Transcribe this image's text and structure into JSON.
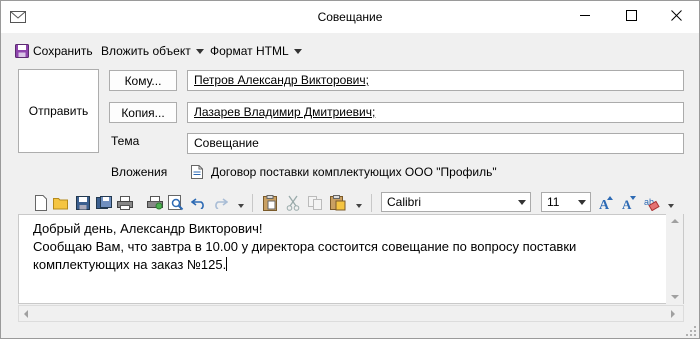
{
  "window": {
    "title": "Совещание",
    "controls": [
      "minimize-icon",
      "maximize-icon",
      "close-icon"
    ]
  },
  "menu": {
    "save": "Сохранить",
    "attach": "Вложить объект",
    "format": "Формат HTML"
  },
  "compose": {
    "send": "Отправить",
    "to_button": "Кому...",
    "to_value": "Петров Александр Викторович;",
    "cc_button": "Копия...",
    "cc_value": "Лазарев Владимир Дмитриевич;",
    "subject_label": "Тема",
    "subject_value": "Совещание",
    "attachments_label": "Вложения",
    "attachment_name": "Договор поставки комплектующих ООО \"Профиль\""
  },
  "toolbar": {
    "icons": [
      "new-document-icon",
      "open-folder-icon",
      "save-icon",
      "save-as-icon",
      "print-icon",
      "print-setup-icon",
      "print-preview-icon",
      "undo-icon",
      "redo-icon",
      "paste-icon",
      "cut-icon",
      "copy-icon",
      "paste-special-icon",
      "grow-font-icon",
      "shrink-font-icon",
      "clear-format-icon"
    ],
    "font_name": "Calibri",
    "font_size": "11"
  },
  "body": {
    "line1": "Добрый день, Александр Викторович!",
    "line2": "Сообщаю Вам, что завтра в 10.00 у директора состоится совещание по вопросу поставки",
    "line3": "комплектующих на заказ №125."
  },
  "colors": {
    "accent": "#7b3a96",
    "link": "#000000",
    "blue_icon": "#2d6ab4"
  }
}
